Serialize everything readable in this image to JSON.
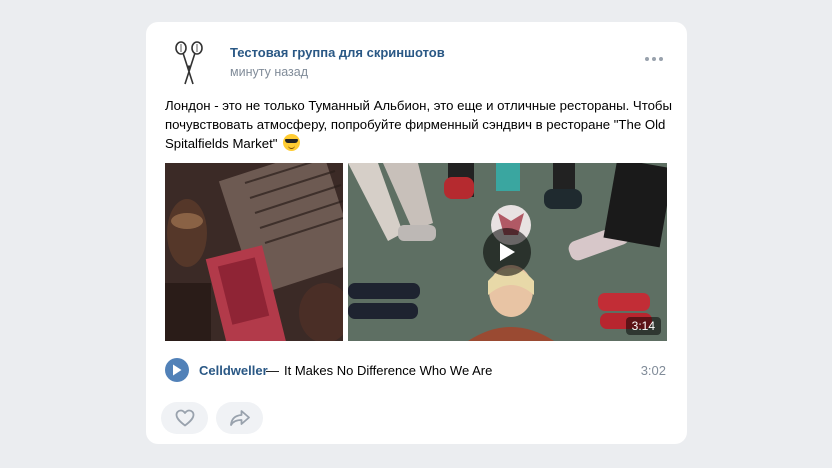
{
  "post": {
    "author": "Тестовая группа для скриншотов",
    "time": "минуту назад",
    "text": "Лондон - это не только Туманный Альбион, это еще и отличные рестораны. Чтобы почувствовать атмосферу, попробуйте фирменный сэндвич в ресторане \"The Old Spitalfields Market\"",
    "emoji_icon": "sunglasses-emoji-icon",
    "more_icon": "more-horizontal-icon"
  },
  "video": {
    "duration": "3:14",
    "play_icon": "play-icon"
  },
  "audio": {
    "artist": "Celldweller",
    "separator": "—",
    "title": "It Makes No Difference Who We Are",
    "duration": "3:02",
    "play_icon": "play-icon"
  },
  "actions": {
    "like_icon": "heart-icon",
    "share_icon": "share-icon"
  },
  "colors": {
    "background": "#ebedf0",
    "link": "#2a5885",
    "secondary_text": "#818c99",
    "audio_button": "#5181b8",
    "action_button": "#f0f2f5"
  }
}
